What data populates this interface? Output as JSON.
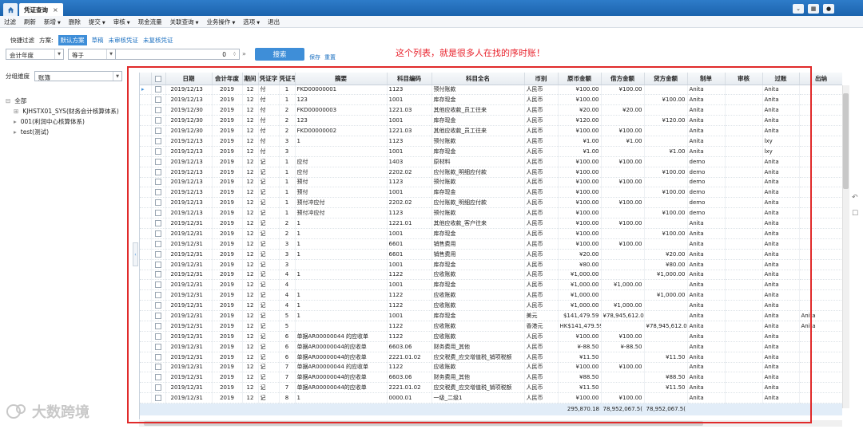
{
  "tab": {
    "title": "凭证查询",
    "close": "×"
  },
  "menu": [
    {
      "label": "过滤",
      "dropdown": false
    },
    {
      "label": "刷新",
      "dropdown": false
    },
    {
      "label": "新增",
      "dropdown": true
    },
    {
      "label": "删除",
      "dropdown": false
    },
    {
      "label": "提交",
      "dropdown": true
    },
    {
      "label": "审核",
      "dropdown": true
    },
    {
      "label": "现金流量",
      "dropdown": false
    },
    {
      "label": "关联查询",
      "dropdown": true
    },
    {
      "label": "业务操作",
      "dropdown": true
    },
    {
      "label": "选项",
      "dropdown": true
    },
    {
      "label": "退出",
      "dropdown": false
    }
  ],
  "filter": {
    "quick_filter_label": "快捷过滤",
    "scheme_label": "方案:",
    "scheme_selected": "默认方案",
    "scheme_links": [
      "草稿",
      "未审核凭证",
      "未复核凭证"
    ],
    "field": "会计年度",
    "operator": "等于",
    "value": "0",
    "search": "搜索",
    "save": "保存",
    "reset": "重置"
  },
  "annotation": "这个列表，就是很多人在找的序时账！",
  "group": {
    "label": "分组维度",
    "value": "账簿"
  },
  "tree": [
    {
      "label": "全部",
      "level": 0,
      "prefix": "⊟"
    },
    {
      "label": "KJHSTX01_SYS(财务会计核算体系)",
      "level": 1,
      "prefix": "⊞"
    },
    {
      "label": "001(利润中心核算体系)",
      "level": 1,
      "prefix": "▸"
    },
    {
      "label": "test(测试)",
      "level": 1,
      "prefix": "▸"
    }
  ],
  "columns": [
    "",
    "",
    "日期",
    "会计年度",
    "期间",
    "凭证字",
    "凭证号",
    "摘要",
    "科目编码",
    "科目全名",
    "币别",
    "原币金额",
    "借方金额",
    "贷方金额",
    "制单",
    "审核",
    "过账",
    "出纳"
  ],
  "rows": [
    [
      "2019/12/13",
      "2019",
      "12",
      "付",
      "1",
      "FKD00000001",
      "1123",
      "预付账款",
      "人民币",
      "¥100.00",
      "¥100.00",
      "",
      "Anita",
      "",
      "Anita",
      ""
    ],
    [
      "2019/12/13",
      "2019",
      "12",
      "付",
      "1",
      "123",
      "1001",
      "库存现金",
      "人民币",
      "¥100.00",
      "",
      "¥100.00",
      "Anita",
      "",
      "Anita",
      ""
    ],
    [
      "2019/12/30",
      "2019",
      "12",
      "付",
      "2",
      "FKD00000003",
      "1221.03",
      "其他应收款_员工往来",
      "人民币",
      "¥20.00",
      "¥20.00",
      "",
      "Anita",
      "",
      "Anita",
      ""
    ],
    [
      "2019/12/30",
      "2019",
      "12",
      "付",
      "2",
      "123",
      "1001",
      "库存现金",
      "人民币",
      "¥120.00",
      "",
      "¥120.00",
      "Anita",
      "",
      "Anita",
      ""
    ],
    [
      "2019/12/30",
      "2019",
      "12",
      "付",
      "2",
      "FKD00000002",
      "1221.03",
      "其他应收款_员工往来",
      "人民币",
      "¥100.00",
      "¥100.00",
      "",
      "Anita",
      "",
      "Anita",
      ""
    ],
    [
      "2019/12/13",
      "2019",
      "12",
      "付",
      "3",
      "1",
      "1123",
      "预付账款",
      "人民币",
      "¥1.00",
      "¥1.00",
      "",
      "Anita",
      "",
      "lxy",
      ""
    ],
    [
      "2019/12/13",
      "2019",
      "12",
      "付",
      "3",
      "",
      "1001",
      "库存现金",
      "人民币",
      "¥1.00",
      "",
      "¥1.00",
      "Anita",
      "",
      "lxy",
      ""
    ],
    [
      "2019/12/13",
      "2019",
      "12",
      "记",
      "1",
      "应付",
      "1403",
      "原材料",
      "人民币",
      "¥100.00",
      "¥100.00",
      "",
      "demo",
      "",
      "Anita",
      ""
    ],
    [
      "2019/12/13",
      "2019",
      "12",
      "记",
      "1",
      "应付",
      "2202.02",
      "应付账款_明细应付款",
      "人民币",
      "¥100.00",
      "",
      "¥100.00",
      "demo",
      "",
      "Anita",
      ""
    ],
    [
      "2019/12/13",
      "2019",
      "12",
      "记",
      "1",
      "预付",
      "1123",
      "预付账款",
      "人民币",
      "¥100.00",
      "¥100.00",
      "",
      "demo",
      "",
      "Anita",
      ""
    ],
    [
      "2019/12/13",
      "2019",
      "12",
      "记",
      "1",
      "预付",
      "1001",
      "库存现金",
      "人民币",
      "¥100.00",
      "",
      "¥100.00",
      "demo",
      "",
      "Anita",
      ""
    ],
    [
      "2019/12/13",
      "2019",
      "12",
      "记",
      "1",
      "预付冲应付",
      "2202.02",
      "应付账款_明细应付款",
      "人民币",
      "¥100.00",
      "¥100.00",
      "",
      "demo",
      "",
      "Anita",
      ""
    ],
    [
      "2019/12/13",
      "2019",
      "12",
      "记",
      "1",
      "预付冲应付",
      "1123",
      "预付账款",
      "人民币",
      "¥100.00",
      "",
      "¥100.00",
      "demo",
      "",
      "Anita",
      ""
    ],
    [
      "2019/12/31",
      "2019",
      "12",
      "记",
      "2",
      "1",
      "1221.01",
      "其他应收款_客户往来",
      "人民币",
      "¥100.00",
      "¥100.00",
      "",
      "Anita",
      "",
      "Anita",
      ""
    ],
    [
      "2019/12/31",
      "2019",
      "12",
      "记",
      "2",
      "1",
      "1001",
      "库存现金",
      "人民币",
      "¥100.00",
      "",
      "¥100.00",
      "Anita",
      "",
      "Anita",
      ""
    ],
    [
      "2019/12/31",
      "2019",
      "12",
      "记",
      "3",
      "1",
      "6601",
      "销售费用",
      "人民币",
      "¥100.00",
      "¥100.00",
      "",
      "Anita",
      "",
      "Anita",
      ""
    ],
    [
      "2019/12/31",
      "2019",
      "12",
      "记",
      "3",
      "1",
      "6601",
      "销售费用",
      "人民币",
      "¥20.00",
      "",
      "¥20.00",
      "Anita",
      "",
      "Anita",
      ""
    ],
    [
      "2019/12/31",
      "2019",
      "12",
      "记",
      "3",
      "",
      "1001",
      "库存现金",
      "人民币",
      "¥80.00",
      "",
      "¥80.00",
      "Anita",
      "",
      "Anita",
      ""
    ],
    [
      "2019/12/31",
      "2019",
      "12",
      "记",
      "4",
      "1",
      "1122",
      "应收账款",
      "人民币",
      "¥1,000.00",
      "",
      "¥1,000.00",
      "Anita",
      "",
      "Anita",
      ""
    ],
    [
      "2019/12/31",
      "2019",
      "12",
      "记",
      "4",
      "",
      "1001",
      "库存现金",
      "人民币",
      "¥1,000.00",
      "¥1,000.00",
      "",
      "Anita",
      "",
      "Anita",
      ""
    ],
    [
      "2019/12/31",
      "2019",
      "12",
      "记",
      "4",
      "1",
      "1122",
      "应收账款",
      "人民币",
      "¥1,000.00",
      "",
      "¥1,000.00",
      "Anita",
      "",
      "Anita",
      ""
    ],
    [
      "2019/12/31",
      "2019",
      "12",
      "记",
      "4",
      "1",
      "1122",
      "应收账款",
      "人民币",
      "¥1,000.00",
      "¥1,000.00",
      "",
      "Anita",
      "",
      "Anita",
      ""
    ],
    [
      "2019/12/31",
      "2019",
      "12",
      "记",
      "5",
      "1",
      "1001",
      "库存现金",
      "美元",
      "$141,479.59",
      "¥78,945,612.00",
      "",
      "Anita",
      "",
      "Anita",
      "Anita"
    ],
    [
      "2019/12/31",
      "2019",
      "12",
      "记",
      "5",
      "",
      "1122",
      "应收账款",
      "香港元",
      "HK$141,479.59",
      "",
      "¥78,945,612.00",
      "Anita",
      "",
      "Anita",
      "Anita"
    ],
    [
      "2019/12/31",
      "2019",
      "12",
      "记",
      "6",
      "单据AR00000044          的应收单",
      "1122",
      "应收账款",
      "人民币",
      "¥100.00",
      "¥100.00",
      "",
      "Anita",
      "",
      "Anita",
      ""
    ],
    [
      "2019/12/31",
      "2019",
      "12",
      "记",
      "6",
      "单据AR00000044的应收单",
      "6603.06",
      "财务费用_其他",
      "人民币",
      "¥-88.50",
      "¥-88.50",
      "",
      "Anita",
      "",
      "Anita",
      ""
    ],
    [
      "2019/12/31",
      "2019",
      "12",
      "记",
      "6",
      "单据AR00000044的应收单",
      "2221.01.02",
      "应交税费_应交增值税_销项税额",
      "人民币",
      "¥11.50",
      "",
      "¥11.50",
      "Anita",
      "",
      "Anita",
      ""
    ],
    [
      "2019/12/31",
      "2019",
      "12",
      "记",
      "7",
      "单据AR00000044          的应收单",
      "1122",
      "应收账款",
      "人民币",
      "¥100.00",
      "¥100.00",
      "",
      "Anita",
      "",
      "Anita",
      ""
    ],
    [
      "2019/12/31",
      "2019",
      "12",
      "记",
      "7",
      "单据AR00000044的应收单",
      "6603.06",
      "财务费用_其他",
      "人民币",
      "¥88.50",
      "",
      "¥88.50",
      "Anita",
      "",
      "Anita",
      ""
    ],
    [
      "2019/12/31",
      "2019",
      "12",
      "记",
      "7",
      "单据AR00000044的应收单",
      "2221.01.02",
      "应交税费_应交增值税_销项税额",
      "人民币",
      "¥11.50",
      "",
      "¥11.50",
      "Anita",
      "",
      "Anita",
      ""
    ],
    [
      "2019/12/31",
      "2019",
      "12",
      "记",
      "8",
      "1",
      "0000.01",
      "一级_二级1",
      "人民币",
      "¥100.00",
      "¥100.00",
      "",
      "Anita",
      "",
      "Anita",
      ""
    ]
  ],
  "totals": {
    "original": "295,870.18",
    "debit": "78,952,067.5(",
    "credit": "78,952,067.5("
  },
  "watermark": "大数跨境"
}
